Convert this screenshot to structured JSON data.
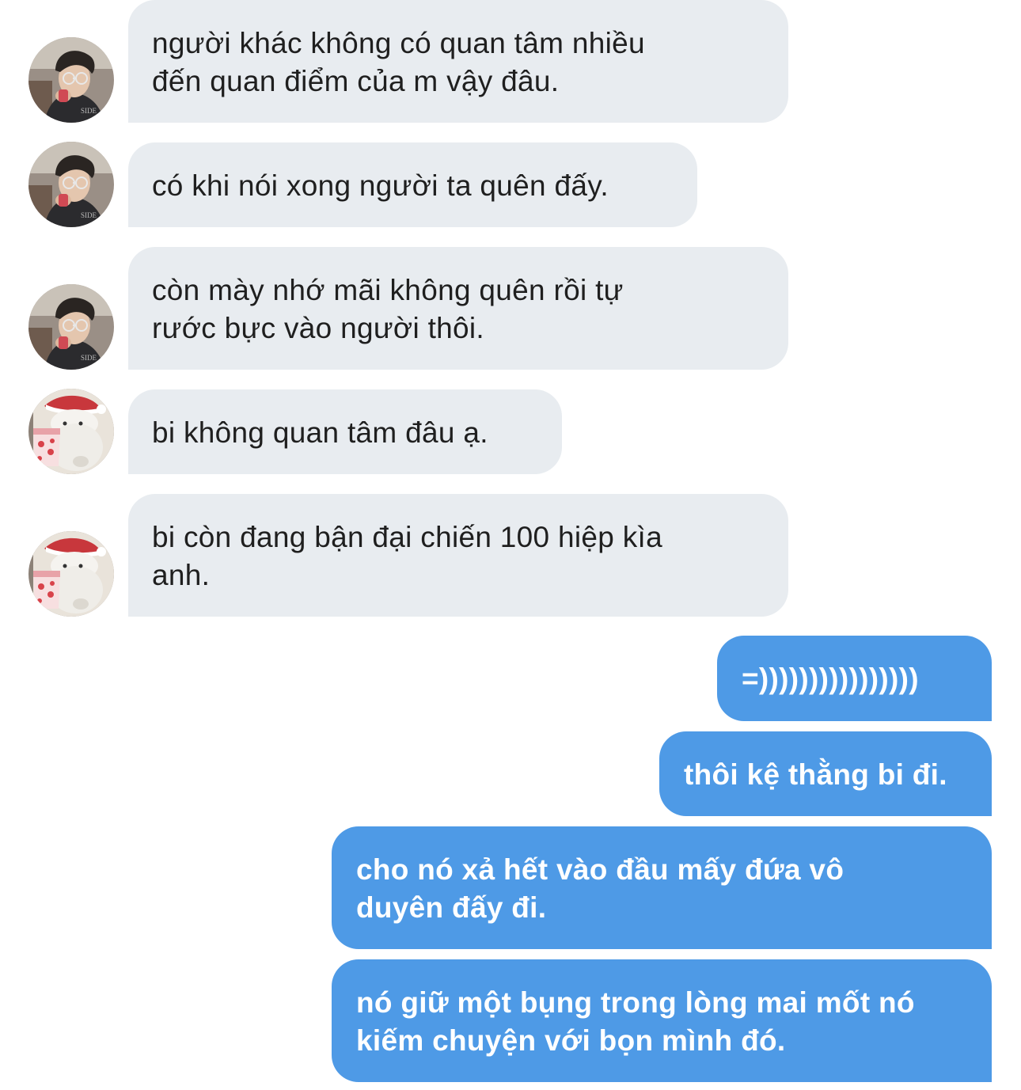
{
  "conversation": {
    "messages": [
      {
        "direction": "incoming",
        "sender_avatar": "boy-photo-avatar",
        "lines": [
          "người khác không có quan tâm nhiều",
          "đến quan điểm của m vậy đâu."
        ]
      },
      {
        "direction": "incoming",
        "sender_avatar": "boy-photo-avatar",
        "lines": [
          "có khi nói xong người ta quên đấy."
        ]
      },
      {
        "direction": "incoming",
        "sender_avatar": "boy-photo-avatar",
        "lines": [
          "còn mày nhớ mãi không quên rồi tự",
          "rước bực vào người thôi."
        ]
      },
      {
        "direction": "incoming",
        "sender_avatar": "bear-sticker-avatar",
        "lines": [
          "bi không quan tâm đâu ạ."
        ]
      },
      {
        "direction": "incoming",
        "sender_avatar": "bear-sticker-avatar",
        "lines": [
          "bi còn đang bận đại chiến 100 hiệp kìa",
          "anh."
        ]
      },
      {
        "direction": "outgoing",
        "lines": [
          "=))))))))))))))))"
        ]
      },
      {
        "direction": "outgoing",
        "lines": [
          "thôi kệ thằng bi đi."
        ]
      },
      {
        "direction": "outgoing",
        "lines": [
          "cho nó xả hết vào đầu mấy đứa vô",
          "duyên đấy đi."
        ]
      },
      {
        "direction": "outgoing",
        "lines": [
          "nó giữ một bụng trong lòng mai mốt nó",
          "kiếm chuyện với bọn mình đó."
        ]
      }
    ]
  },
  "colors": {
    "incoming_bubble": "#e8ecf0",
    "incoming_text": "#1f1f1f",
    "outgoing_bubble": "#4e9ae6",
    "outgoing_text": "#ffffff",
    "background": "#ffffff"
  }
}
